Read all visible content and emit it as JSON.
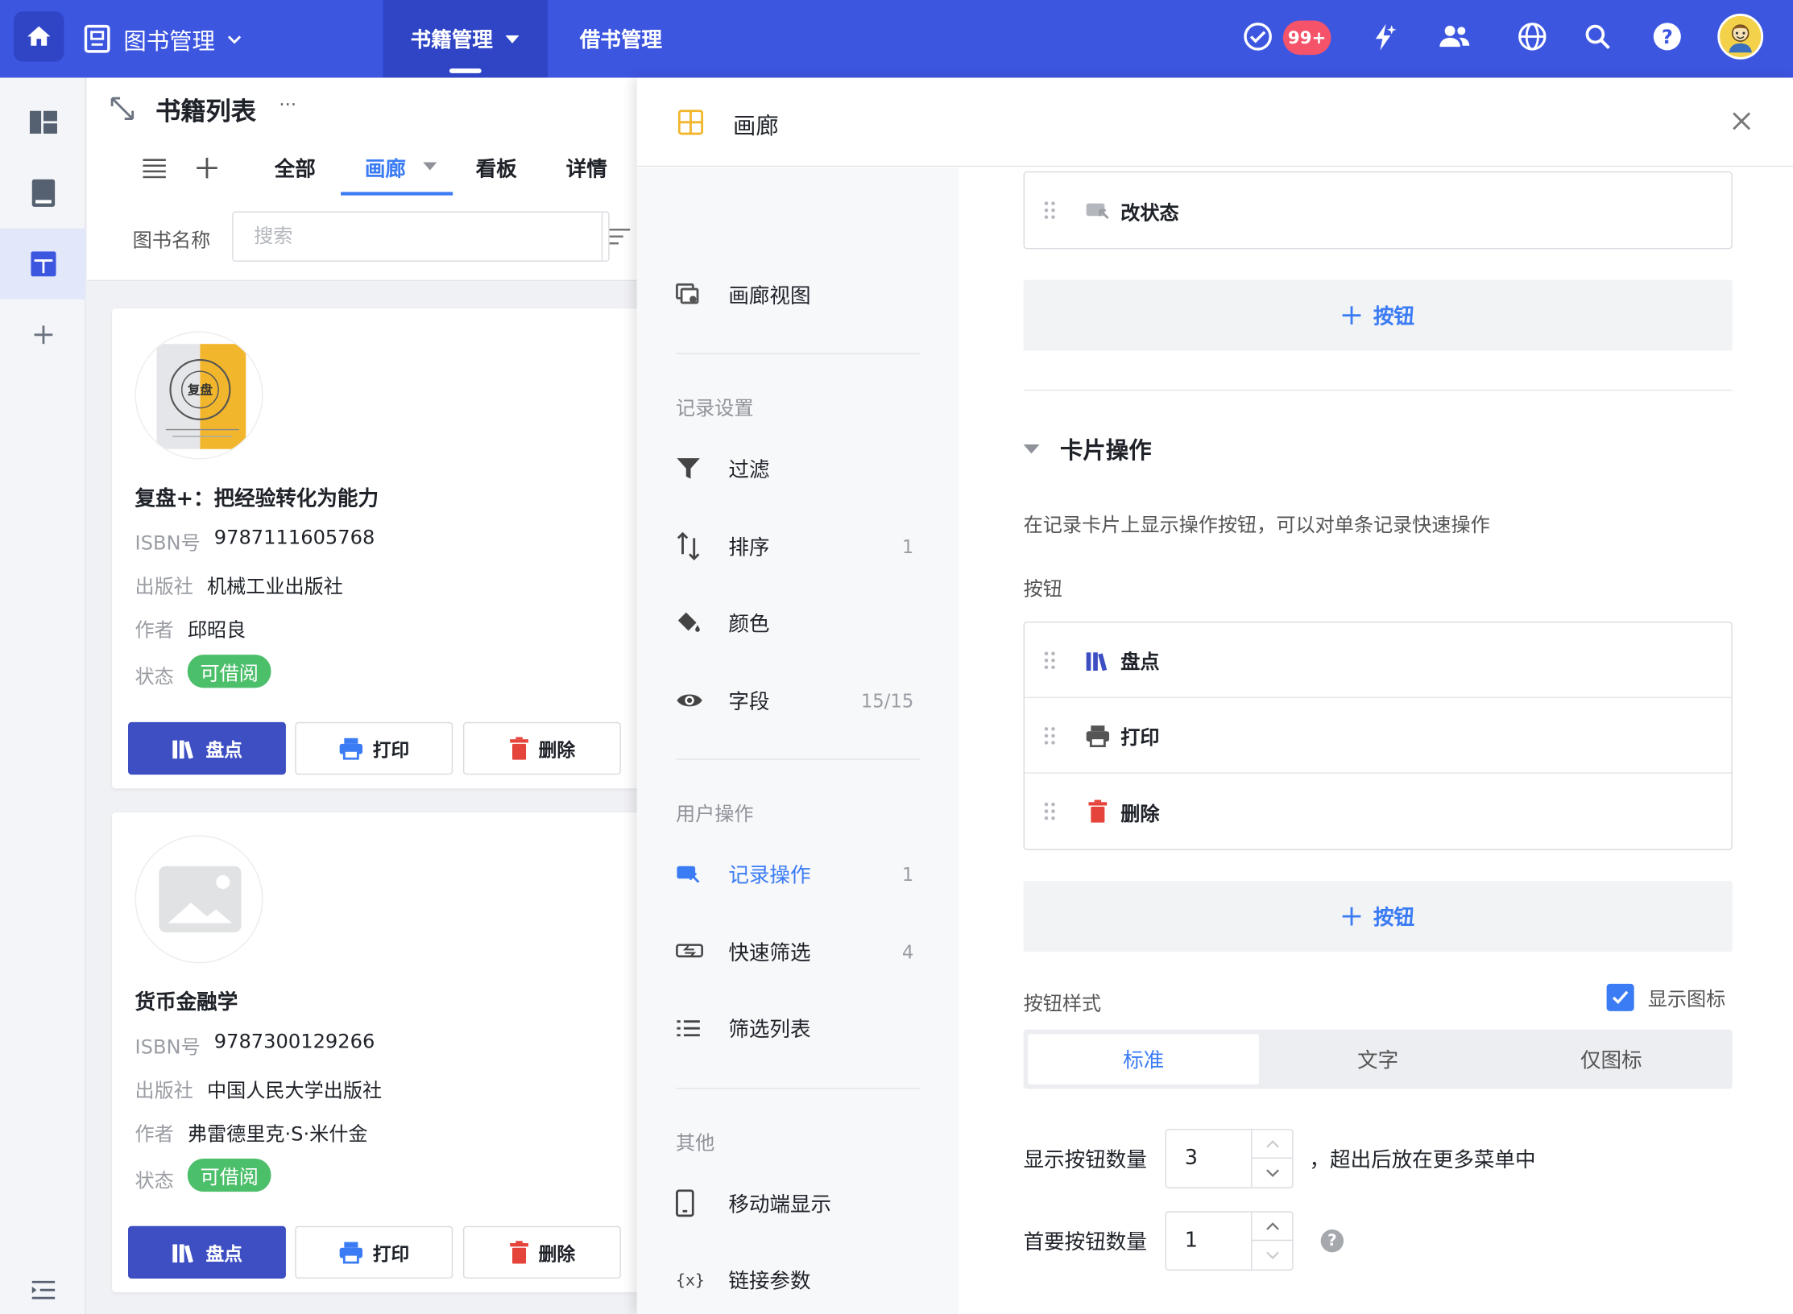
{
  "topbar": {
    "app_title": "图书管理",
    "nav": [
      {
        "label": "书籍管理"
      },
      {
        "label": "借书管理"
      }
    ],
    "badge": "99+",
    "colors": {
      "bar": "#3d56e0",
      "active": "#2f45c6"
    }
  },
  "main": {
    "title": "书籍列表",
    "more": "···",
    "tabs": [
      {
        "label": "全部"
      },
      {
        "label": "画廊"
      },
      {
        "label": "看板"
      },
      {
        "label": "详情"
      }
    ],
    "filter_label": "图书名称",
    "search_placeholder": "搜索",
    "field_labels": {
      "isbn": "ISBN号",
      "publisher": "出版社",
      "author": "作者",
      "status": "状态"
    },
    "cards": [
      {
        "title": "复盘+：把经验转化为能力",
        "isbn": "9787111605768",
        "publisher": "机械工业出版社",
        "author": "邱昭良",
        "status": "可借阅",
        "cover_text": "复盘"
      },
      {
        "title": "货币金融学",
        "isbn": "9787300129266",
        "publisher": "中国人民大学出版社",
        "author": "弗雷德里克·S·米什金",
        "status": "可借阅"
      }
    ],
    "card_buttons": [
      {
        "label": "盘点"
      },
      {
        "label": "打印"
      },
      {
        "label": "删除"
      }
    ]
  },
  "drawer": {
    "title": "画廊",
    "menu": {
      "gallery_view": "画廊视图",
      "record_settings": "记录设置",
      "filter": "过滤",
      "sort": "排序",
      "sort_count": "1",
      "color": "颜色",
      "fields": "字段",
      "fields_count": "15/15",
      "user_actions": "用户操作",
      "record_actions": "记录操作",
      "record_actions_count": "1",
      "quick_filter": "快速筛选",
      "quick_filter_count": "4",
      "filter_list": "筛选列表",
      "other": "其他",
      "mobile": "移动端显示",
      "link_params": "链接参数"
    },
    "record_buttons": [
      {
        "label": "改状态"
      }
    ],
    "add_button": "按钮",
    "card_actions": {
      "title": "卡片操作",
      "description": "在记录卡片上显示操作按钮，可以对单条记录快速操作",
      "buttons_label": "按钮",
      "buttons": [
        {
          "label": "盘点"
        },
        {
          "label": "打印"
        },
        {
          "label": "删除"
        }
      ],
      "add_button": "按钮",
      "style_label": "按钮样式",
      "show_icon": "显示图标",
      "style_options": [
        {
          "label": "标准"
        },
        {
          "label": "文字"
        },
        {
          "label": "仅图标"
        }
      ],
      "visible_count_label": "显示按钮数量",
      "visible_count": "3",
      "visible_count_suffix": "，超出后放在更多菜单中",
      "primary_count_label": "首要按钮数量",
      "primary_count": "1"
    }
  }
}
